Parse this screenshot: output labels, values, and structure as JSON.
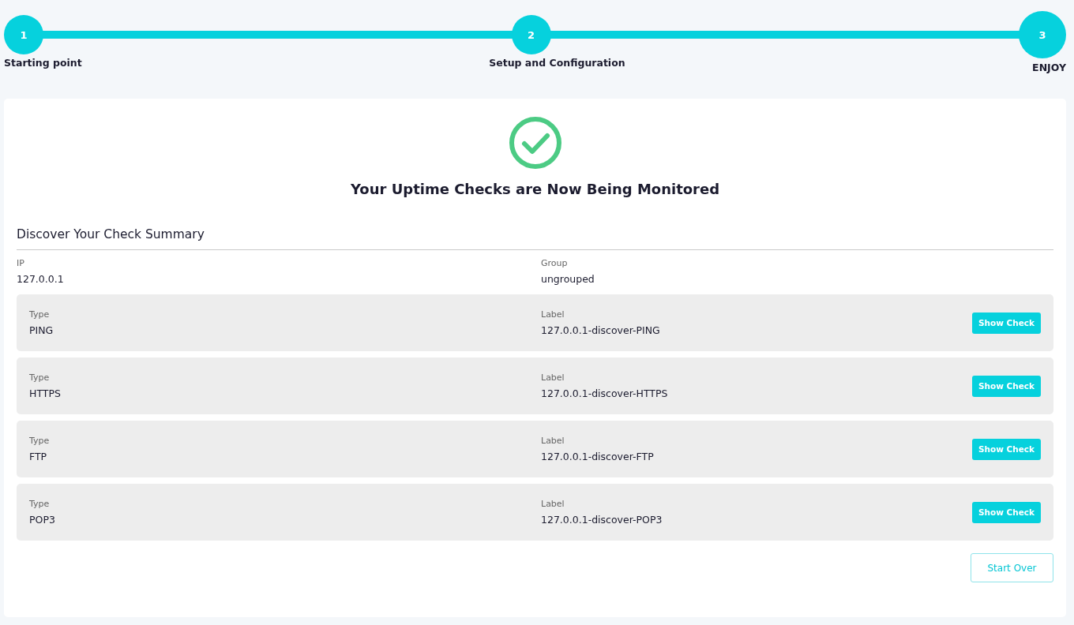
{
  "steps": [
    {
      "number": "1",
      "label": "Starting point",
      "selected": false
    },
    {
      "number": "2",
      "label": "Setup and Configuration",
      "selected": false
    },
    {
      "number": "3",
      "label": "ENJOY",
      "selected": true
    }
  ],
  "title": "Your Uptime Checks are Now Being Monitored",
  "summary": {
    "heading": "Discover Your Check Summary",
    "fields": [
      {
        "label": "IP",
        "value": "127.0.0.1"
      },
      {
        "label": "Group",
        "value": "ungrouped"
      }
    ]
  },
  "checks": [
    {
      "type_label": "Type",
      "type": "PING",
      "label_label": "Label",
      "label": "127.0.0.1-discover-PING",
      "button": "Show Check"
    },
    {
      "type_label": "Type",
      "type": "HTTPS",
      "label_label": "Label",
      "label": "127.0.0.1-discover-HTTPS",
      "button": "Show Check"
    },
    {
      "type_label": "Type",
      "type": "FTP",
      "label_label": "Label",
      "label": "127.0.0.1-discover-FTP",
      "button": "Show Check"
    },
    {
      "type_label": "Type",
      "type": "POP3",
      "label_label": "Label",
      "label": "127.0.0.1-discover-POP3",
      "button": "Show Check"
    }
  ],
  "start_over": "Start Over"
}
